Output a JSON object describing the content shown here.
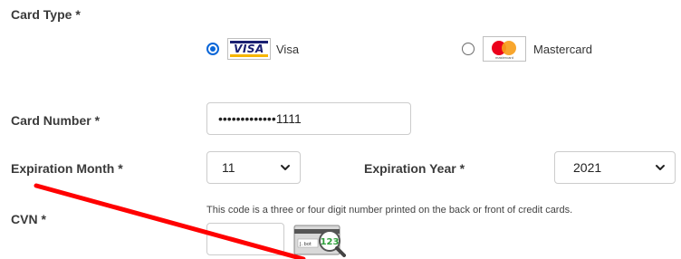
{
  "card_type": {
    "label": "Card Type *",
    "options": [
      {
        "label": "Visa",
        "logo_text": "VISA",
        "selected": true,
        "icon": "visa-logo-icon"
      },
      {
        "label": "Mastercard",
        "logo_text": "mastercard",
        "selected": false,
        "icon": "mastercard-logo-icon"
      }
    ]
  },
  "card_number": {
    "label": "Card Number *",
    "value": "•••••••••••••1111"
  },
  "expiration": {
    "month_label": "Expiration Month *",
    "month_value": "11",
    "year_label": "Expiration Year *",
    "year_value": "2021"
  },
  "cvn": {
    "label": "CVN *",
    "hint": "This code is a three or four digit number printed on the back or front of credit cards.",
    "value": "",
    "help_image_text": "123",
    "help_image_signature": "J. bot",
    "help_icon": "magnifier-card-icon"
  },
  "annotation": {
    "color": "#ff0000",
    "icon": "red-strike-line"
  }
}
